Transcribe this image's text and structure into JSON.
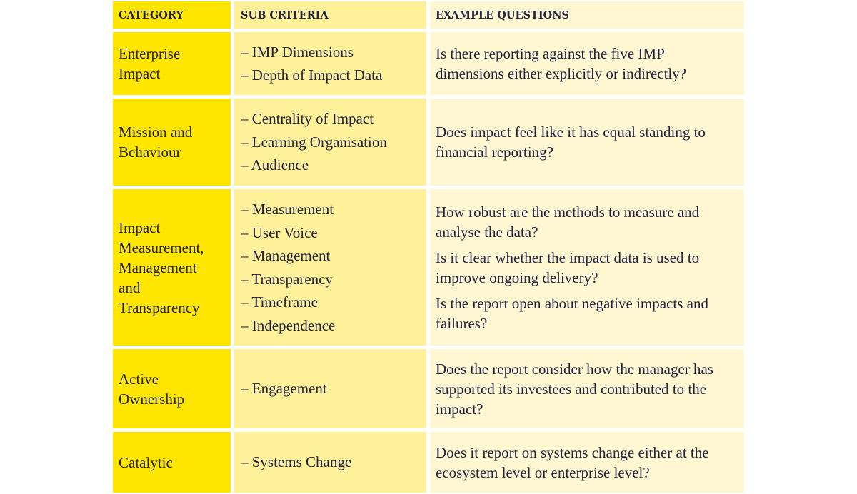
{
  "headers": {
    "category": "CATEGORY",
    "sub_criteria": "SUB CRITERIA",
    "example_questions": "EXAMPLE QUESTIONS"
  },
  "rows": [
    {
      "category": [
        "Enterprise",
        "Impact"
      ],
      "sub_criteria": [
        "– IMP Dimensions",
        "– Depth of Impact Data"
      ],
      "questions": [
        "Is there reporting against the five IMP dimensions either explicitly or indirectly?"
      ]
    },
    {
      "category": [
        "Mission and",
        "Behaviour"
      ],
      "sub_criteria": [
        "– Centrality of Impact",
        "– Learning Organisation",
        "– Audience"
      ],
      "questions": [
        "Does impact feel like it has equal standing to financial reporting?"
      ]
    },
    {
      "category": [
        "Impact",
        "Measurement,",
        "Management",
        "and",
        "Transparency"
      ],
      "sub_criteria": [
        "– Measurement",
        "– User Voice",
        "– Management",
        "– Transparency",
        "– Timeframe",
        "– Independence"
      ],
      "questions": [
        "How robust are the methods to measure and analyse the data?",
        "Is it clear whether the impact data is used to improve ongoing delivery?",
        "Is the report open about negative impacts and failures?"
      ]
    },
    {
      "category": [
        "Active",
        "Ownership"
      ],
      "sub_criteria": [
        "– Engagement"
      ],
      "questions": [
        "Does the report consider how the manager has supported its investees and contributed to the impact?"
      ]
    },
    {
      "category": [
        "Catalytic"
      ],
      "sub_criteria": [
        "– Systems Change"
      ],
      "questions": [
        "Does it report on systems change either at the ecosystem level or enterprise level?"
      ]
    }
  ],
  "colors": {
    "category_bg": "#ffe600",
    "sub_criteria_bg": "#fff09a",
    "questions_bg": "#fff7d1",
    "text": "#232342"
  }
}
